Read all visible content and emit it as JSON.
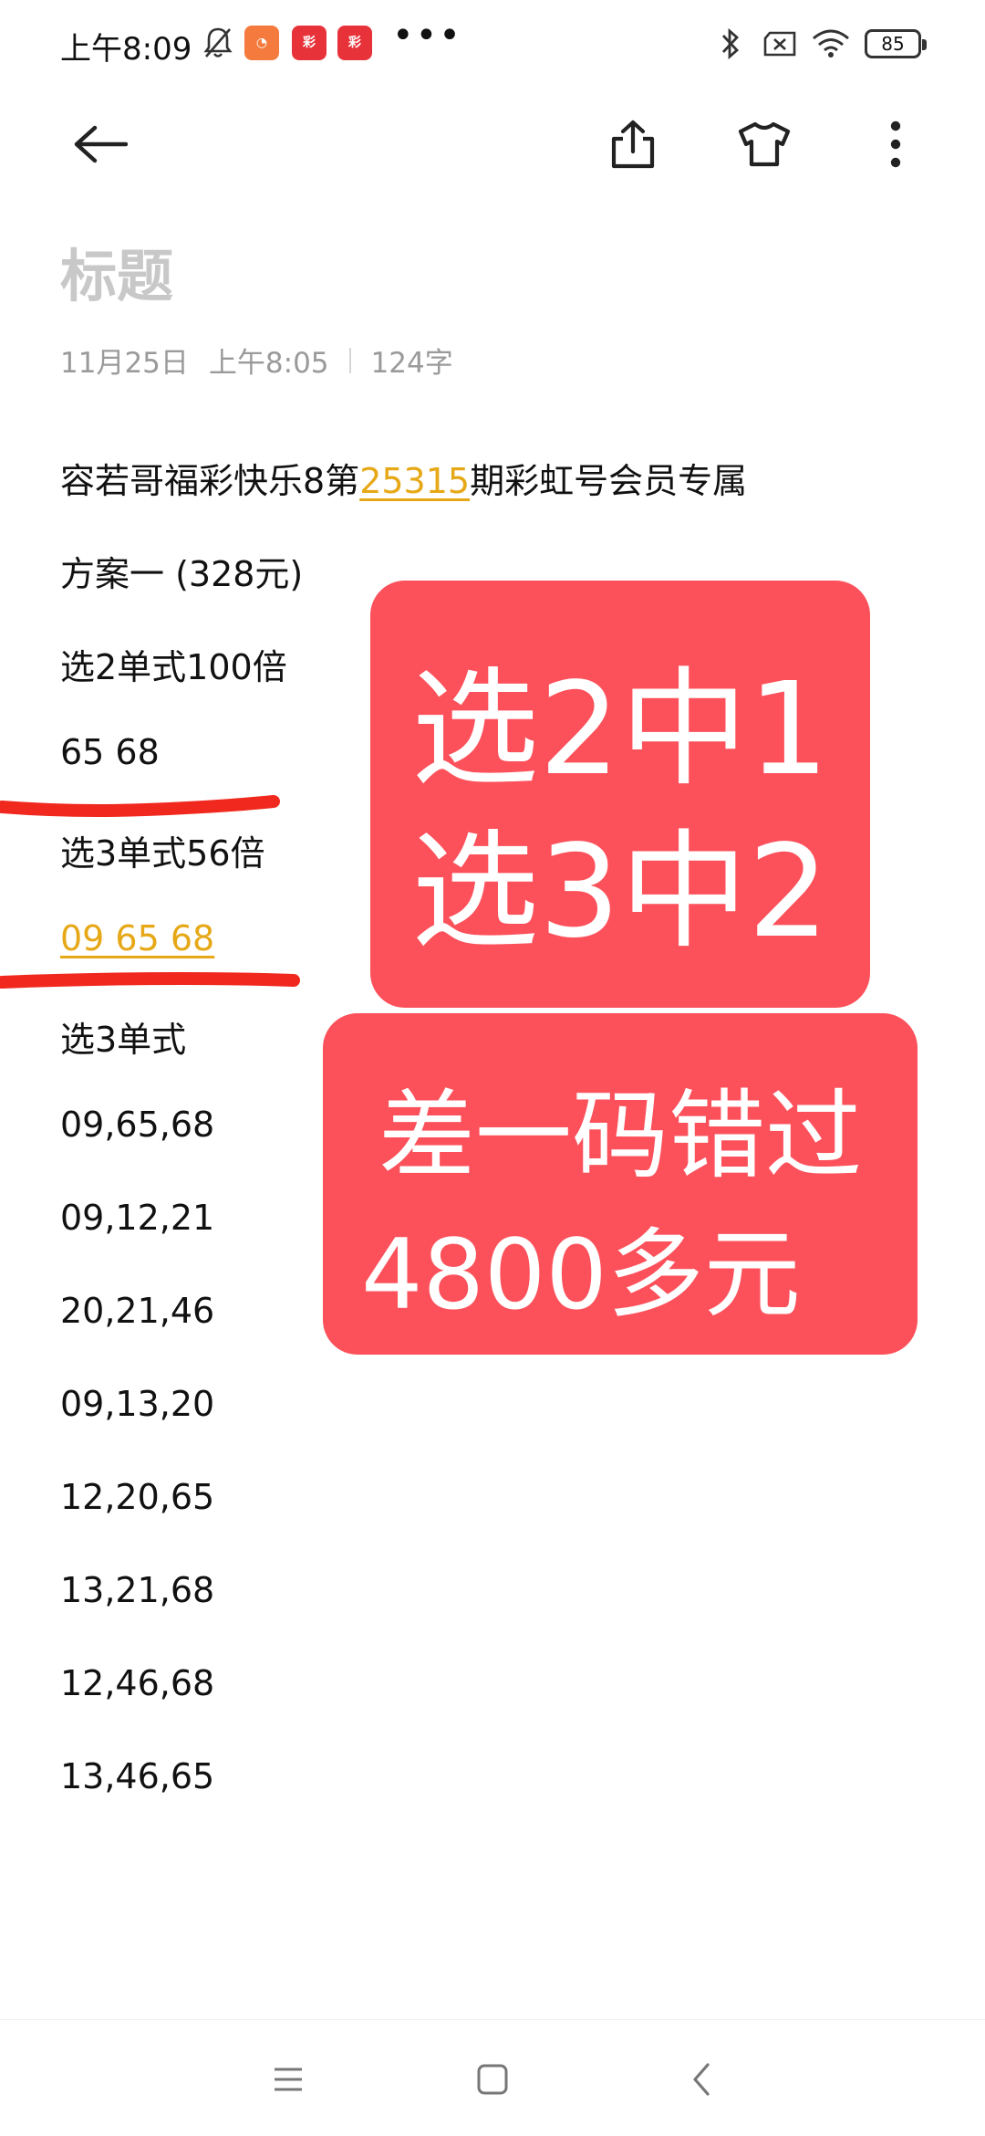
{
  "status_bar": {
    "time": "上午8:09",
    "app_icons": [
      "bell-off-icon",
      "orange-app-icon",
      "red-app-icon",
      "red-app-icon"
    ],
    "more": "•••",
    "battery": "85",
    "accent_red": "#e8323a",
    "accent_orange": "#f47b3d"
  },
  "note": {
    "title": "标题",
    "date": "11月25日",
    "time": "上午8:05",
    "word_count": "124字",
    "headline_pre": "容若哥福彩快乐8第",
    "headline_link": "25315",
    "headline_post": "期彩虹号会员专属",
    "lines": [
      "方案一 (328元)",
      "选2单式100倍",
      "65 68",
      "选3单式56倍",
      "09 65 68",
      "选3单式",
      "09,65,68",
      "09,12,21",
      "20,21,46",
      "09,13,20",
      "12,20,65",
      "13,21,68",
      "12,46,68",
      "13,46,65"
    ]
  },
  "overlay1": {
    "line1": "选2中1",
    "line2": "选3中2",
    "color": "#fc515b"
  },
  "overlay2": {
    "line1": "差一码错过",
    "line2": "4800多元",
    "color": "#fc515b"
  },
  "colors": {
    "link": "#e6a817",
    "stroke": "#f0281e",
    "title_gray": "#c8c8c8"
  }
}
